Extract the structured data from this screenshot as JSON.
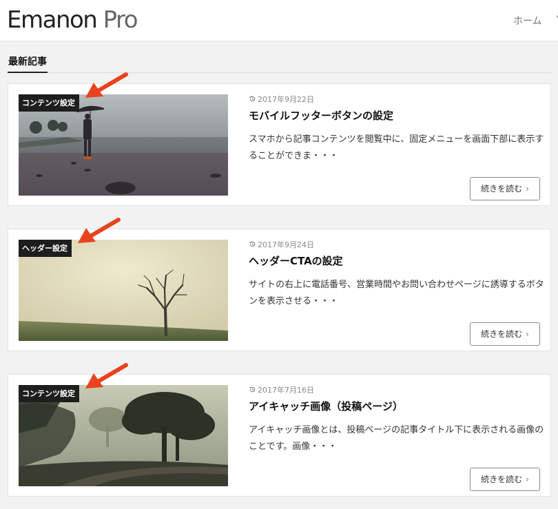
{
  "header": {
    "logo_main": "Emanon",
    "logo_pro": " Pro",
    "nav_home": "ホーム"
  },
  "section": {
    "title": "最新記事"
  },
  "posts": [
    {
      "category": "コンテンツ設定",
      "date": "2017年9月22日",
      "title": "モバイルフッターボタンの設定",
      "excerpt": "スマホから記事コンテンツを閲覧中に、固定メニューを画面下部に表示することができま・・・",
      "more_label": "続きを読む"
    },
    {
      "category": "ヘッダー設定",
      "date": "2017年9月24日",
      "title": "ヘッダーCTAの設定",
      "excerpt": "サイトの右上に電話番号、営業時間やお問い合わせページに誘導するボタンを表示させる・・・",
      "more_label": "続きを読む"
    },
    {
      "category": "コンテンツ設定",
      "date": "2017年7月16日",
      "title": "アイキャッチ画像（投稿ページ）",
      "excerpt": "アイキャッチ画像とは、投稿ページの記事タイトル下に表示される画像のことです。画像・・・",
      "more_label": "続きを読む"
    }
  ],
  "colors": {
    "annotation_arrow": "#e8431e",
    "badge_bg": "#1e1e1e"
  },
  "icons": {
    "date": "clock-refresh-icon",
    "more": "chevron-right-icon",
    "annotation": "red-arrow-pointer"
  }
}
